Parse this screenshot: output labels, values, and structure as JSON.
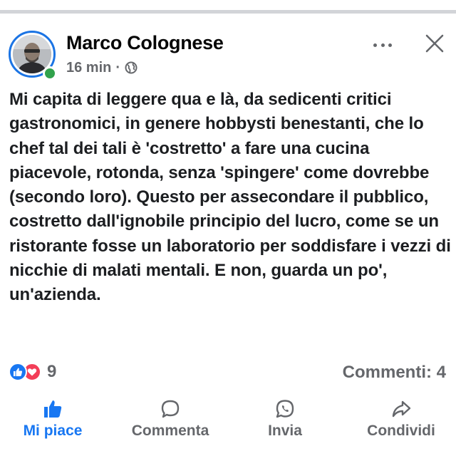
{
  "post": {
    "author": "Marco Colognese",
    "time": "16 min",
    "separator": "·",
    "audience_icon": "globe-icon",
    "text": "Mi capita di leggere qua e là, da sedicenti critici gastronomici, in genere hobbysti benestanti, che lo chef tal dei tali è 'costretto' a fare una cucina piacevole, rotonda, senza 'spingere' come dovrebbe (secondo loro). Questo per assecondare il pubblico, costretto dall'ignobile principio del lucro, come se un ristorante fosse un laboratorio per soddisfare i vezzi di nicchie di malati mentali. E non, guarda un po', un'azienda."
  },
  "reactions": {
    "count": "9",
    "types": [
      "like",
      "love"
    ]
  },
  "comments": {
    "label": "Commenti: 4"
  },
  "actions": [
    {
      "label": "Mi piace",
      "icon": "thumbs-up-icon",
      "active": true
    },
    {
      "label": "Commenta",
      "icon": "comment-bubble-icon",
      "active": false
    },
    {
      "label": "Invia",
      "icon": "whatsapp-icon",
      "active": false
    },
    {
      "label": "Condividi",
      "icon": "share-arrow-icon",
      "active": false
    }
  ],
  "colors": {
    "accent": "#1877f2",
    "online": "#31a24c",
    "love": "#f33e58",
    "secondary_text": "#65676b",
    "avatar_ring": "#1b74e4"
  }
}
